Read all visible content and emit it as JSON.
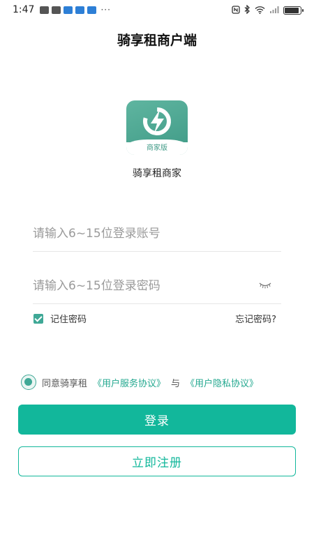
{
  "status_bar": {
    "time": "1:47",
    "more": "···",
    "battery_level": 0.9
  },
  "header": {
    "title": "骑享租商户端"
  },
  "app": {
    "badge": "商家版",
    "name": "骑享租商家"
  },
  "form": {
    "account_placeholder": "请输入6~15位登录账号",
    "password_placeholder": "请输入6~15位登录密码",
    "remember_label": "记住密码",
    "remember_checked": true,
    "forgot_label": "忘记密码?"
  },
  "agreement": {
    "prefix": "同意骑享租",
    "service_link": "《用户服务协议》",
    "connector": "与",
    "privacy_link": "《用户隐私协议》",
    "accepted": true
  },
  "actions": {
    "login_label": "登录",
    "register_label": "立即注册"
  },
  "colors": {
    "accent": "#12b79b",
    "logo": "#4ea892",
    "link": "#23a88f"
  }
}
